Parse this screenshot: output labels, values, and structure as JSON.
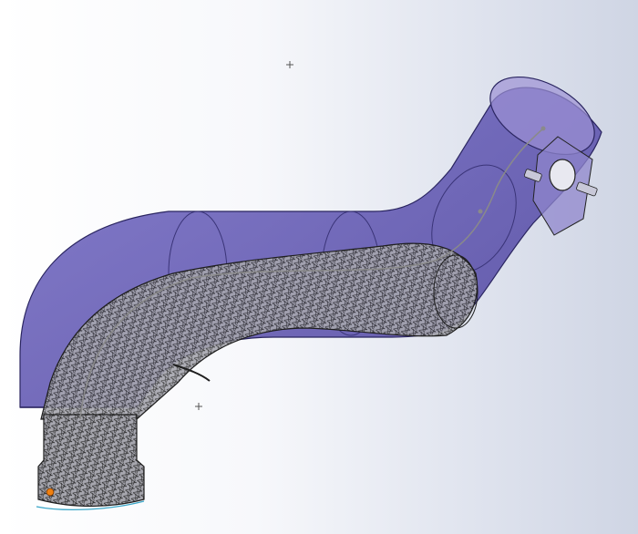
{
  "viewport": {
    "background_light": "#ffffff",
    "background_dark": "#cfd5e4"
  },
  "model": {
    "shell_color": "#5a4fb0",
    "shell_edge_color": "#2a2560",
    "mesh_color": "#2b2b2b",
    "mesh_fill": "#9a9aa4",
    "path_color": "#8a8a8a",
    "point_color": "#f08010",
    "icons": [
      "origin-marker-icon",
      "pivot-point-icon"
    ]
  }
}
